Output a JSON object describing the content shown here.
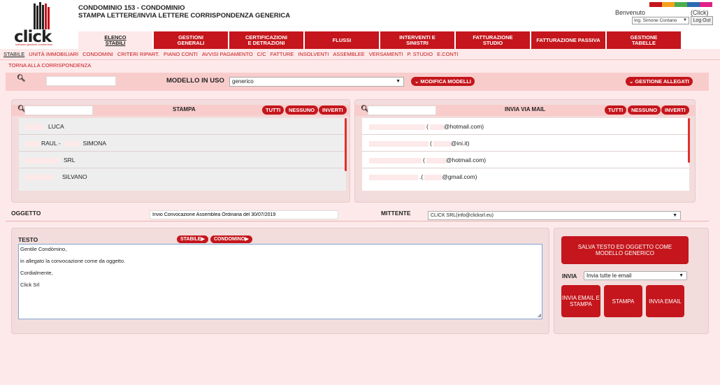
{
  "header": {
    "title_line1": "CONDOMINIO 153 - CONDOMINIO",
    "title_line2": "STAMPA LETTERE/INVIA LETTERE CORRISPONDENZA GENERICA",
    "welcome": "Benvenuto",
    "click_label": "(Click)",
    "user": "Ing. Simone Cordano",
    "logout": "Log Out",
    "logo_text": "click",
    "logo_sub": "software gestione condominio",
    "color_bar": [
      "#c4161c",
      "#f4a11d",
      "#4cae4c",
      "#2b6cb0",
      "#e0218a"
    ]
  },
  "main_nav": [
    {
      "line1": "ELENCO",
      "line2": "STABILI",
      "active": true
    },
    {
      "line1": "GESTIONI",
      "line2": "GENERALI"
    },
    {
      "line1": "CERTIFICAZIONI",
      "line2": "E DETRAZIONI"
    },
    {
      "line1": "FLUSSI",
      "line2": ""
    },
    {
      "line1": "INTERVENTI E",
      "line2": "SINISTRI"
    },
    {
      "line1": "FATTURAZIONE",
      "line2": "STUDIO"
    },
    {
      "line1": "FATTURAZIONE PASSIVA",
      "line2": ""
    },
    {
      "line1": "GESTIONE",
      "line2": "TABELLE"
    }
  ],
  "sub_nav": [
    "STABILE",
    "UNITÀ IMMOBILIARI",
    "CONDOMINI",
    "CRITERI RIPART.",
    "PIANO CONTI",
    "AVVISI PAGAMENTO",
    "C/C",
    "FATTURE",
    "INSOLVENTI",
    "ASSEMBLEE",
    "VERSAMENTI",
    "P. STUDIO",
    "E.CONTI"
  ],
  "back_link": "TORNA ALLA CORRISPONDENZA",
  "model_bar": {
    "label": "MODELLO IN USO",
    "value": "generico",
    "edit_button": "MODIFICA MODELLI",
    "attachments_button": "GESTIONE ALLEGATI"
  },
  "print_panel": {
    "title": "STAMPA",
    "btn_all": "TUTTI",
    "btn_none": "NESSUNO",
    "btn_invert": "INVERTI",
    "rows": [
      {
        "blank": 28,
        "text": "LUCA"
      },
      {
        "blank": 22,
        "text": "RAUL -",
        "blank2": 22,
        "text2": "SIMONA"
      },
      {
        "blank": 50,
        "text": "SRL"
      },
      {
        "blank": 42,
        "text": "SILVANO"
      }
    ]
  },
  "mail_panel": {
    "title": "INVIA VIA MAIL",
    "btn_all": "TUTTI",
    "btn_none": "NESSUNO",
    "btn_invert": "INVERTI",
    "rows": [
      {
        "blank": 80,
        "text": "(",
        "blank2": 20,
        "text2": "@hotmail.com)"
      },
      {
        "blank": 85,
        "text": "(",
        "blank2": 25,
        "text2": "@ini.it)"
      },
      {
        "blank": 75,
        "text": "(",
        "blank2": 28,
        "text2": "@hotmail.com)"
      },
      {
        "blank": 70,
        "text": ".(",
        "blank2": 25,
        "text2": "@gmail.com)"
      }
    ]
  },
  "subject": {
    "label": "OGGETTO",
    "value": "Invio Convocazione Assemblea Ordinaria del 30/07/2019"
  },
  "sender": {
    "label": "MITTENTE",
    "value": "CLICK SRL(info@clicksrl.eu)"
  },
  "text_panel": {
    "label": "TESTO",
    "tag_stabile": "STABILE",
    "tag_condomino": "CONDOMINO",
    "lines": [
      "Gentile Condòmino,",
      "",
      "in allegato la convocazione come da oggetto.",
      "",
      "Cordialmente,",
      "",
      "Click Srl"
    ]
  },
  "actions": {
    "save_template": "SALVA TESTO ED OGGETTO COME MODELLO GENERICO",
    "send_label": "INVIA",
    "send_value": "Invia tutte le email",
    "btn_email_print": "INVIA EMAIL E STAMPA",
    "btn_print": "STAMPA",
    "btn_email": "INVIA EMAIL"
  }
}
